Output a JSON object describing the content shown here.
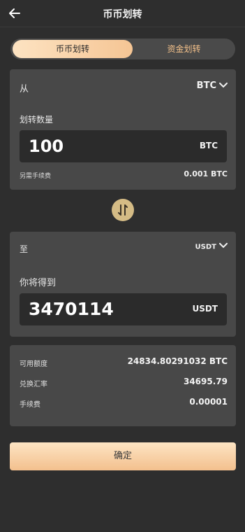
{
  "header": {
    "title": "币币划转",
    "back_icon": "arrow-left-icon"
  },
  "tabs": [
    {
      "label": "币币划转",
      "active": true
    },
    {
      "label": "资金划转",
      "active": false
    }
  ],
  "from": {
    "label": "从",
    "currency": "BTC",
    "amount_label": "划转数量",
    "amount": "100",
    "amount_unit": "BTC",
    "fee_label": "另需手续费",
    "fee_value": "0.001 BTC"
  },
  "swap": {
    "icon": "swap-vertical-icon"
  },
  "to": {
    "label": "至",
    "currency": "USDT",
    "receive_label": "你将得到",
    "receive_amount": "3470114",
    "receive_unit": "USDT"
  },
  "info": {
    "available_label": "可用额度",
    "available_value": "24834.80291032 BTC",
    "rate_label": "兑换汇率",
    "rate_value": "34695.79",
    "fee_label": "手续费",
    "fee_value": "0.00001"
  },
  "confirm": {
    "label": "确定"
  },
  "colors": {
    "background": "#2e2e2e",
    "card": "#484848",
    "accent": "#f5c594",
    "swap_button": "#d4bb85"
  }
}
